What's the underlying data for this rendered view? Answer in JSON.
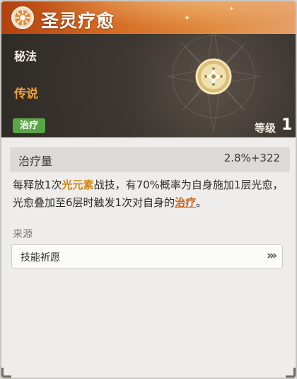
{
  "header": {
    "title": "圣灵疗愈"
  },
  "hero": {
    "category": "秘法",
    "rarity": "传说",
    "tag": "治疗",
    "level_label": "等级",
    "level_value": "1"
  },
  "stat": {
    "label": "治疗量",
    "value": "2.8%+322"
  },
  "description": {
    "part1": "每释放1次",
    "highlight": "光元素",
    "part2": "战技，有70%概率为自身施加1层光愈，光愈叠加至6层时触发1次对自身的",
    "link": "治疗",
    "part3": "。"
  },
  "source": {
    "label": "来源",
    "item": "技能祈愿"
  },
  "colors": {
    "header": "#d46a22",
    "rarity": "#f0a237",
    "tag": "#5aa548",
    "highlight": "#d08a19"
  },
  "icons": {
    "badge": "sun-emblem-icon",
    "emblem": "holy-gem-icon",
    "chevron": "double-chevron-right-icon"
  }
}
